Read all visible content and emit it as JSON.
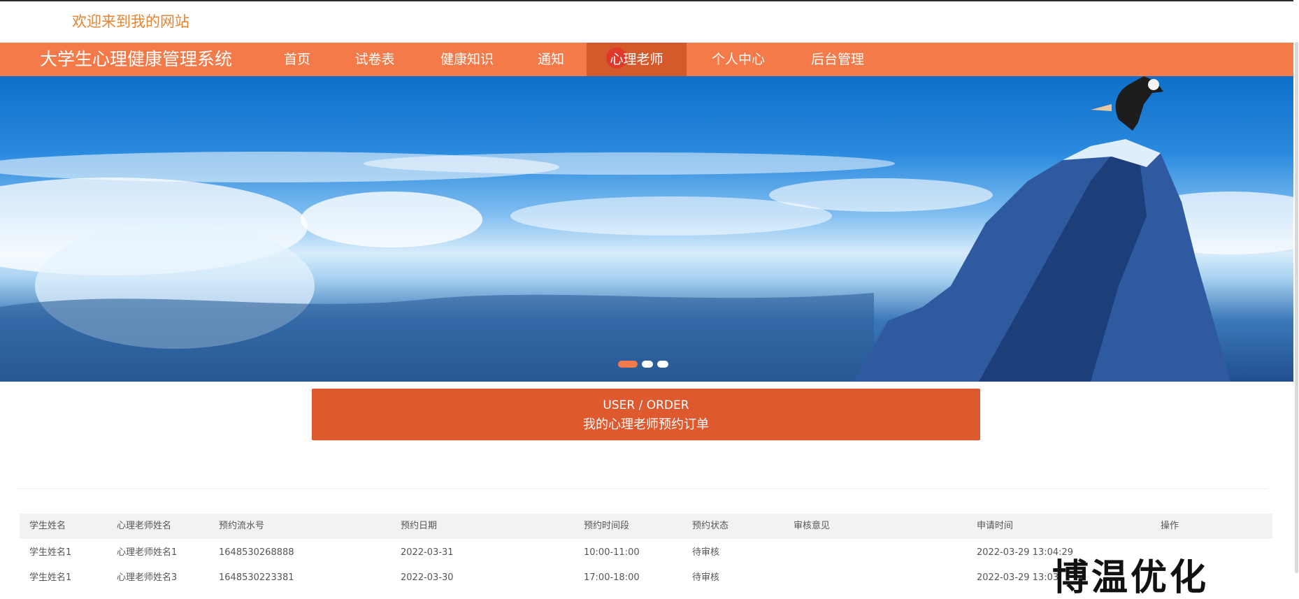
{
  "header": {
    "welcome": "欢迎来到我的网站"
  },
  "nav": {
    "site_title": "大学生心理健康管理系统",
    "items": [
      "首页",
      "试卷表",
      "健康知识",
      "通知",
      "心理老师",
      "个人中心",
      "后台管理"
    ],
    "active": "心理老师"
  },
  "banner": {
    "slide_count": 3,
    "active_slide": 1
  },
  "order": {
    "title_en": "USER / ORDER",
    "title_cn": "我的心理老师预约订单"
  },
  "table": {
    "headers": [
      "学生姓名",
      "心理老师姓名",
      "预约流水号",
      "预约日期",
      "预约时间段",
      "预约状态",
      "审核意见",
      "申请时间",
      "操作"
    ],
    "rows": [
      [
        "学生姓名1",
        "心理老师姓名1",
        "1648530268888",
        "2022-03-31",
        "10:00-11:00",
        "待审核",
        "",
        "2022-03-29 13:04:29",
        ""
      ],
      [
        "学生姓名1",
        "心理老师姓名3",
        "1648530223381",
        "2022-03-30",
        "17:00-18:00",
        "待审核",
        "",
        "2022-03-29 13:03:",
        ""
      ]
    ]
  },
  "overlay": {
    "text": "博温优化"
  },
  "colors": {
    "nav_bg": "#f47a4a",
    "nav_active": "#d45a2b",
    "order_bg": "#de5a2e",
    "welcome": "#e8832f"
  }
}
